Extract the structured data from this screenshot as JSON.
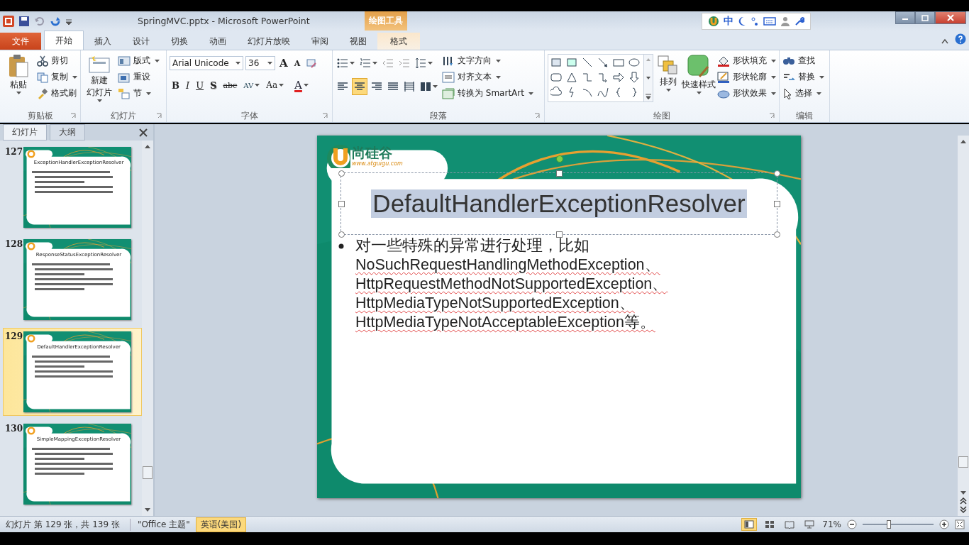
{
  "window": {
    "title": "SpringMVC.pptx - Microsoft PowerPoint",
    "context_group": "绘图工具"
  },
  "ime": {
    "label": "中"
  },
  "tabs": [
    {
      "label": "文件",
      "kind": "file",
      "selected": false
    },
    {
      "label": "开始",
      "kind": "normal",
      "selected": true
    },
    {
      "label": "插入",
      "kind": "normal",
      "selected": false
    },
    {
      "label": "设计",
      "kind": "normal",
      "selected": false
    },
    {
      "label": "切换",
      "kind": "normal",
      "selected": false
    },
    {
      "label": "动画",
      "kind": "normal",
      "selected": false
    },
    {
      "label": "幻灯片放映",
      "kind": "normal",
      "selected": false
    },
    {
      "label": "审阅",
      "kind": "normal",
      "selected": false
    },
    {
      "label": "视图",
      "kind": "normal",
      "selected": false
    },
    {
      "label": "格式",
      "kind": "context",
      "selected": false
    }
  ],
  "ribbon": {
    "groups": [
      {
        "kind": "standard",
        "label": "剪贴板",
        "large": [
          {
            "label_lines": [
              "粘贴"
            ],
            "dropdown": true
          }
        ],
        "small": [
          {
            "label": "剪切",
            "dropdown": false
          },
          {
            "label": "复制",
            "dropdown": true
          },
          {
            "label": "格式刷",
            "dropdown": false
          }
        ]
      },
      {
        "kind": "standard",
        "label": "幻灯片",
        "large": [
          {
            "label_lines": [
              "新建",
              "幻灯片"
            ],
            "dropdown": true
          }
        ],
        "small": [
          {
            "label": "版式",
            "dropdown": true
          },
          {
            "label": "重设",
            "dropdown": false
          },
          {
            "label": "节",
            "dropdown": true
          }
        ]
      },
      {
        "kind": "font",
        "label": "字体",
        "font_name": "Arial Unicode",
        "font_size": "36",
        "size_buttons": [
          "A",
          "A"
        ],
        "format_buttons": [
          "B",
          "I",
          "U",
          "S",
          "abc",
          "AV",
          "Aa"
        ],
        "color_button": "A"
      },
      {
        "kind": "paragraph",
        "label": "段落",
        "align_buttons": [
          {
            "kind": "left",
            "selected": false
          },
          {
            "kind": "center",
            "selected": true
          },
          {
            "kind": "right",
            "selected": false
          },
          {
            "kind": "justify",
            "selected": false
          },
          {
            "kind": "distributed",
            "selected": false
          }
        ],
        "small": [
          {
            "label": "文字方向",
            "dropdown": true
          },
          {
            "label": "对齐文本",
            "dropdown": true
          },
          {
            "label": "转换为 SmartArt",
            "dropdown": true
          }
        ]
      },
      {
        "kind": "drawing",
        "label": "绘图",
        "large": [
          {
            "label_lines": [
              "排列"
            ],
            "dropdown": true
          },
          {
            "label_lines": [
              "快速样式"
            ],
            "dropdown": true
          }
        ],
        "small": [
          {
            "label": "形状填充",
            "dropdown": true
          },
          {
            "label": "形状轮廓",
            "dropdown": true
          },
          {
            "label": "形状效果",
            "dropdown": true
          }
        ]
      },
      {
        "kind": "standard",
        "label": "编辑",
        "small": [
          {
            "label": "查找",
            "dropdown": false
          },
          {
            "label": "替换",
            "dropdown": true
          },
          {
            "label": "选择",
            "dropdown": true
          }
        ]
      }
    ]
  },
  "pane": {
    "tabs": [
      {
        "label": "幻灯片",
        "selected": true
      },
      {
        "label": "大纲",
        "selected": false
      }
    ],
    "slides": [
      {
        "number": "127",
        "title": "ExceptionHandlerExceptionResolver",
        "selected": false
      },
      {
        "number": "128",
        "title": "ResponseStatusExceptionResolver",
        "selected": false
      },
      {
        "number": "129",
        "title": "DefaultHandlerExceptionResolver",
        "selected": true
      },
      {
        "number": "130",
        "title": "SimpleMappingExceptionResolver",
        "selected": false
      }
    ]
  },
  "slide": {
    "logo_name": "尚硅谷",
    "logo_url": "www.atguigu.com",
    "title": "DefaultHandlerExceptionResolver",
    "title_selected": true,
    "bullet_lines": [
      "对一些特殊的异常进行处理，比如",
      "NoSuchRequestHandlingMethodException、",
      "HttpRequestMethodNotSupportedException、",
      "HttpMediaTypeNotSupportedException、",
      "HttpMediaTypeNotAcceptableException等。"
    ]
  },
  "status_bar": {
    "slide_info": "幻灯片 第 129 张，共 139 张",
    "theme": "\"Office 主题\"",
    "language": "英语(美国)",
    "zoom": "71%",
    "zoom_slider": {
      "level": 0.37
    }
  }
}
